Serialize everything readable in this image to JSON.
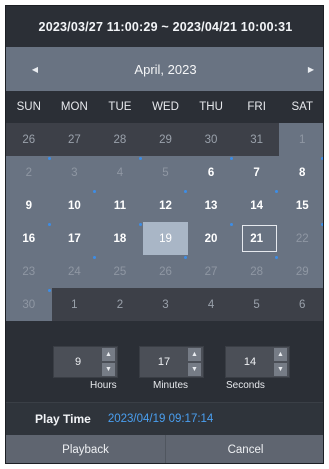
{
  "range": {
    "text": "2023/03/27 11:00:29 ~ 2023/04/21 10:00:31"
  },
  "calendar": {
    "month_label": "April, 2023",
    "prev_icon": "left-arrow-icon",
    "next_icon": "right-arrow-icon",
    "weekdays": [
      "SUN",
      "MON",
      "TUE",
      "WED",
      "THU",
      "FRI",
      "SAT"
    ],
    "weeks": [
      [
        "26",
        "27",
        "28",
        "29",
        "30",
        "31",
        "1"
      ],
      [
        "2",
        "3",
        "4",
        "5",
        "6",
        "7",
        "8"
      ],
      [
        "9",
        "10",
        "11",
        "12",
        "13",
        "14",
        "15"
      ],
      [
        "16",
        "17",
        "18",
        "19",
        "20",
        "21",
        "22"
      ],
      [
        "23",
        "24",
        "25",
        "26",
        "27",
        "28",
        "29"
      ],
      [
        "30",
        "1",
        "2",
        "3",
        "4",
        "5",
        "6"
      ]
    ],
    "selected_date": "19",
    "highlighted_date": "21"
  },
  "time": {
    "hours": {
      "value": "9",
      "label": "Hours"
    },
    "minutes": {
      "value": "17",
      "label": "Minutes"
    },
    "seconds": {
      "value": "14",
      "label": "Seconds"
    }
  },
  "play_time": {
    "label": "Play Time",
    "value": "2023/04/19 09:17:14"
  },
  "actions": {
    "playback_label": "Playback",
    "cancel_label": "Cancel"
  },
  "colors": {
    "panel_bg": "#2b2f36",
    "month_bar_bg": "#697382",
    "selected_bg": "#a9b6c6",
    "accent_blue": "#4a9ff0",
    "button_bg": "#5f6570"
  }
}
